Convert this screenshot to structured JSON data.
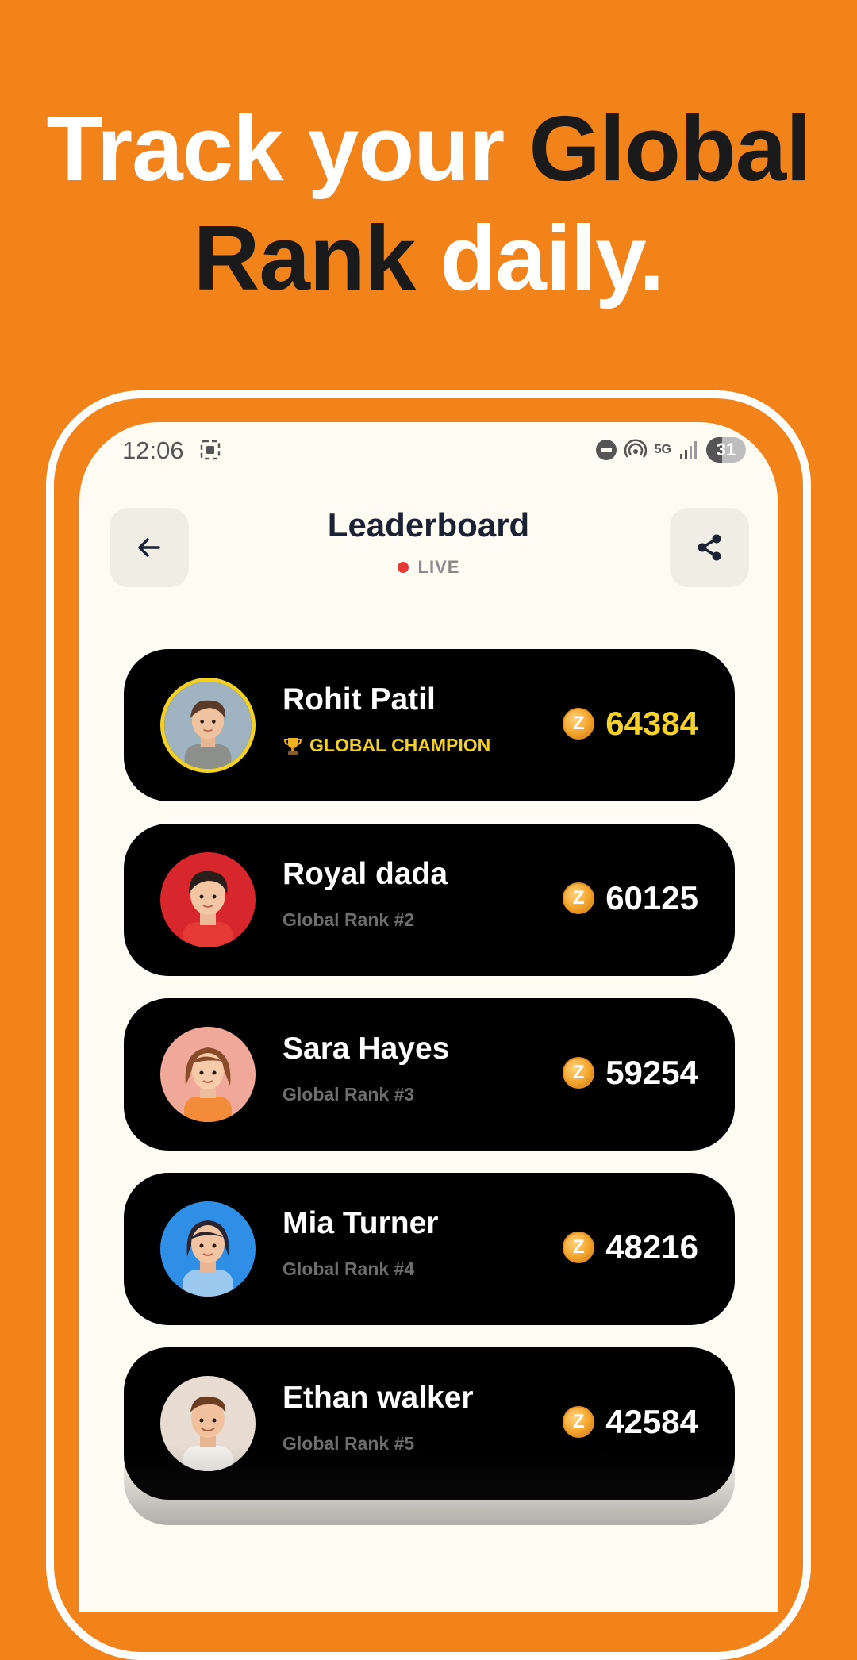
{
  "headline": {
    "part1": "Track your ",
    "part2": "Global",
    "part3": "Rank",
    "part4": " daily."
  },
  "status_bar": {
    "time": "12:06",
    "battery": "31",
    "network": "5G"
  },
  "header": {
    "title": "Leaderboard",
    "live_label": "LIVE"
  },
  "colors": {
    "background": "#F2831B",
    "screen": "#FDFBF2",
    "card": "#000000",
    "gold": "#F7D22A",
    "live": "#E53935"
  },
  "leaderboard": [
    {
      "name": "Rohit Patil",
      "subtitle": "GLOBAL CHAMPION",
      "score": "64384",
      "champion": true
    },
    {
      "name": "Royal dada",
      "subtitle": "Global Rank #2",
      "score": "60125",
      "champion": false
    },
    {
      "name": "Sara Hayes",
      "subtitle": "Global Rank #3",
      "score": "59254",
      "champion": false
    },
    {
      "name": "Mia Turner",
      "subtitle": "Global Rank #4",
      "score": "48216",
      "champion": false
    },
    {
      "name": "Ethan walker",
      "subtitle": "Global Rank #5",
      "score": "42584",
      "champion": false
    }
  ],
  "icons": {
    "back": "arrow-left-icon",
    "share": "share-icon",
    "coin": "coin-icon",
    "trophy": "trophy-icon"
  }
}
